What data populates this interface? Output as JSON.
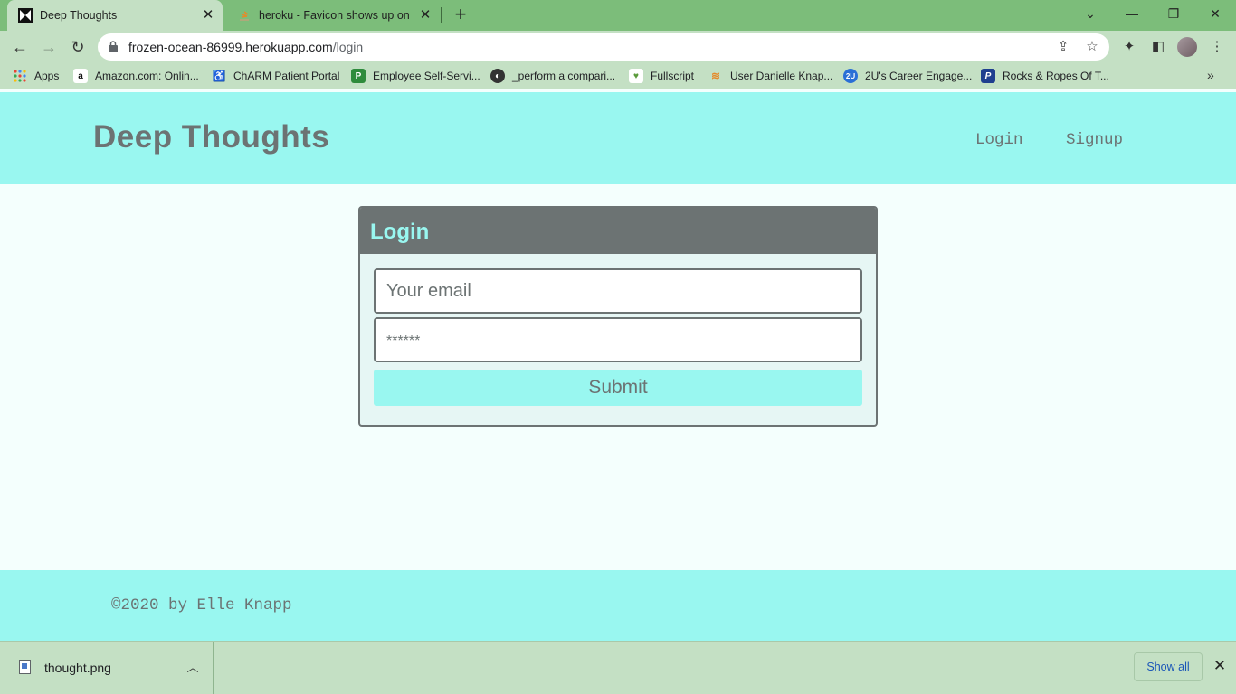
{
  "browser": {
    "tabs": [
      {
        "title": "Deep Thoughts",
        "active": true
      },
      {
        "title": "heroku - Favicon shows up on rai",
        "active": false
      }
    ],
    "new_tab_label": "+",
    "url_host": "frozen-ocean-86999.herokuapp.com",
    "url_path": "/login",
    "bookmarks": [
      {
        "label": "Apps",
        "icon": "apps-grid-icon"
      },
      {
        "label": "Amazon.com: Onlin...",
        "icon": "amazon-icon"
      },
      {
        "label": "ChARM Patient Portal",
        "icon": "charm-icon"
      },
      {
        "label": "Employee Self-Servi...",
        "icon": "paylocity-icon"
      },
      {
        "label": "_perform a compari...",
        "icon": "globe-icon"
      },
      {
        "label": "Fullscript",
        "icon": "fullscript-icon"
      },
      {
        "label": "User Danielle Knap...",
        "icon": "stackoverflow-icon"
      },
      {
        "label": "2U's Career Engage...",
        "icon": "2u-icon"
      },
      {
        "label": "Rocks & Ropes Of T...",
        "icon": "paypal-icon"
      }
    ],
    "bookmark_more": "»"
  },
  "site": {
    "brand": "Deep Thoughts",
    "nav": {
      "login": "Login",
      "signup": "Signup"
    },
    "login_card": {
      "title": "Login",
      "email_placeholder": "Your email",
      "password_placeholder": "******",
      "submit_label": "Submit"
    },
    "footer": "©2020 by Elle Knapp"
  },
  "downloads": {
    "file_name": "thought.png",
    "show_all": "Show all"
  },
  "colors": {
    "accent_teal": "#99f7f0",
    "text_gray": "#6c7373",
    "chrome_green": "#7cbd7a",
    "chrome_light": "#c4e0c4"
  }
}
